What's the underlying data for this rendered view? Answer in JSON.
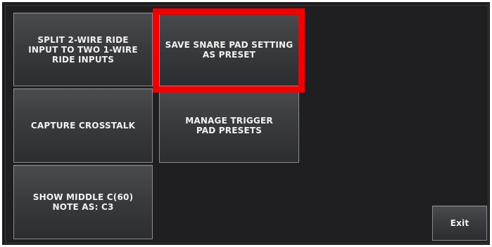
{
  "buttons": {
    "split_ride": "SPLIT 2-WIRE RIDE\nINPUT TO TWO 1-WIRE\nRIDE INPUTS",
    "save_snare": "SAVE SNARE PAD SETTING\nAS PRESET",
    "capture_crosstalk": "CAPTURE CROSSTALK",
    "manage_presets": "MANAGE TRIGGER\nPAD PRESETS",
    "show_middle_c": "SHOW MIDDLE C(60)\nNOTE AS: C3",
    "exit": "Exit"
  },
  "highlight_color": "#f20000"
}
